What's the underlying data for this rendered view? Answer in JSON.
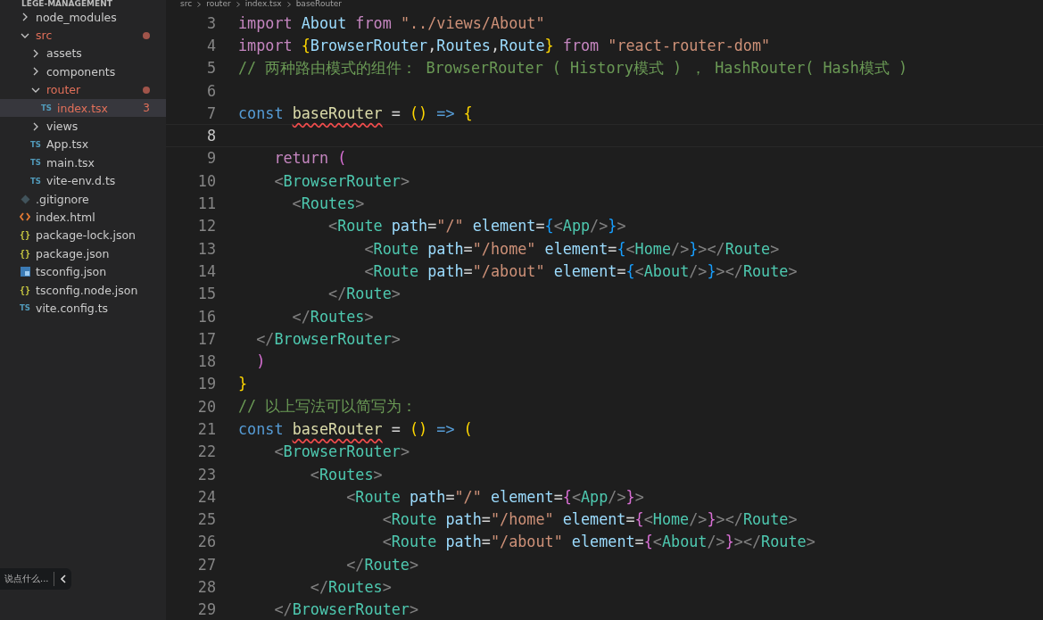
{
  "sidebar": {
    "title": "LEGE-MANAGEMENT",
    "tree": [
      {
        "name": "node_modules",
        "kind": "folder",
        "expanded": false,
        "modified": false,
        "selected": false
      },
      {
        "name": "src",
        "kind": "folder",
        "expanded": true,
        "modified": true,
        "selected": false,
        "children": [
          {
            "name": "assets",
            "kind": "folder",
            "expanded": false,
            "modified": false,
            "selected": false
          },
          {
            "name": "components",
            "kind": "folder",
            "expanded": false,
            "modified": false,
            "selected": false
          },
          {
            "name": "router",
            "kind": "folder",
            "expanded": true,
            "modified": true,
            "selected": false,
            "children": [
              {
                "name": "index.tsx",
                "kind": "ts",
                "modified": true,
                "selected": true,
                "badge": "3",
                "icon_text": "TS"
              }
            ]
          },
          {
            "name": "views",
            "kind": "folder",
            "expanded": false,
            "modified": false,
            "selected": false
          },
          {
            "name": "App.tsx",
            "kind": "ts",
            "modified": false,
            "selected": false,
            "icon_text": "TS"
          },
          {
            "name": "main.tsx",
            "kind": "ts",
            "modified": false,
            "selected": false,
            "icon_text": "TS"
          },
          {
            "name": "vite-env.d.ts",
            "kind": "ts",
            "modified": false,
            "selected": false,
            "icon_text": "TS"
          }
        ]
      },
      {
        "name": ".gitignore",
        "kind": "git",
        "modified": false,
        "selected": false
      },
      {
        "name": "index.html",
        "kind": "html",
        "modified": false,
        "selected": false
      },
      {
        "name": "package-lock.json",
        "kind": "json",
        "modified": false,
        "selected": false,
        "icon_text": "{}"
      },
      {
        "name": "package.json",
        "kind": "json",
        "modified": false,
        "selected": false,
        "icon_text": "{}"
      },
      {
        "name": "tsconfig.json",
        "kind": "tsconfig",
        "modified": false,
        "selected": false
      },
      {
        "name": "tsconfig.node.json",
        "kind": "json",
        "modified": false,
        "selected": false,
        "icon_text": "{}"
      },
      {
        "name": "vite.config.ts",
        "kind": "ts",
        "modified": false,
        "selected": false,
        "icon_text": "TS"
      }
    ]
  },
  "breadcrumb": [
    "src",
    "router",
    "index.tsx",
    "baseRouter"
  ],
  "editor": {
    "lines": [
      {
        "number": "3",
        "current": false,
        "tokens": [
          {
            "kind": "keyword",
            "text": "import "
          },
          {
            "kind": "variable",
            "text": "About "
          },
          {
            "kind": "keyword",
            "text": "from "
          },
          {
            "kind": "string",
            "text": "\"../views/About\""
          }
        ]
      },
      {
        "number": "4",
        "current": false,
        "tokens": [
          {
            "kind": "keyword",
            "text": "import "
          },
          {
            "kind": "bracket1",
            "text": "{"
          },
          {
            "kind": "variable",
            "text": "BrowserRouter"
          },
          {
            "kind": "plain",
            "text": ","
          },
          {
            "kind": "variable",
            "text": "Routes"
          },
          {
            "kind": "plain",
            "text": ","
          },
          {
            "kind": "variable",
            "text": "Route"
          },
          {
            "kind": "bracket1",
            "text": "} "
          },
          {
            "kind": "keyword",
            "text": "from "
          },
          {
            "kind": "string",
            "text": "\"react-router-dom\""
          }
        ]
      },
      {
        "number": "5",
        "current": false,
        "tokens": [
          {
            "kind": "comment",
            "text": "// 两种路由模式的组件： BrowserRouter ( History模式 ) ， HashRouter( Hash模式 )"
          }
        ]
      },
      {
        "number": "6",
        "current": false
      },
      {
        "number": "7",
        "current": false,
        "tokens": [
          {
            "kind": "storage",
            "text": "const "
          },
          {
            "kind": "function",
            "text": "baseRouter",
            "error": true
          },
          {
            "kind": "plain",
            "text": " = "
          },
          {
            "kind": "bracket1",
            "text": "() "
          },
          {
            "kind": "storage",
            "text": "=> "
          },
          {
            "kind": "bracket1",
            "text": "{"
          }
        ]
      },
      {
        "number": "8",
        "current": true
      },
      {
        "number": "9",
        "current": false,
        "tokens": [
          {
            "kind": "keyword",
            "text": "    return "
          },
          {
            "kind": "bracket2",
            "text": "("
          }
        ]
      },
      {
        "number": "10",
        "current": false,
        "tokens": [
          {
            "kind": "punct",
            "text": "    <"
          },
          {
            "kind": "tag",
            "text": "BrowserRouter"
          },
          {
            "kind": "punct",
            "text": ">"
          }
        ]
      },
      {
        "number": "11",
        "current": false,
        "tokens": [
          {
            "kind": "punct",
            "text": "      <"
          },
          {
            "kind": "tag",
            "text": "Routes"
          },
          {
            "kind": "punct",
            "text": ">"
          }
        ]
      },
      {
        "number": "12",
        "current": false,
        "tokens": [
          {
            "kind": "punct",
            "text": "          <"
          },
          {
            "kind": "tag",
            "text": "Route "
          },
          {
            "kind": "attr",
            "text": "path"
          },
          {
            "kind": "plain",
            "text": "="
          },
          {
            "kind": "string",
            "text": "\"/\" "
          },
          {
            "kind": "attr",
            "text": "element"
          },
          {
            "kind": "plain",
            "text": "="
          },
          {
            "kind": "bracket3",
            "text": "{"
          },
          {
            "kind": "punct",
            "text": "<"
          },
          {
            "kind": "tag",
            "text": "App"
          },
          {
            "kind": "punct",
            "text": "/>"
          },
          {
            "kind": "bracket3",
            "text": "}"
          },
          {
            "kind": "punct",
            "text": ">"
          }
        ]
      },
      {
        "number": "13",
        "current": false,
        "tokens": [
          {
            "kind": "punct",
            "text": "              <"
          },
          {
            "kind": "tag",
            "text": "Route "
          },
          {
            "kind": "attr",
            "text": "path"
          },
          {
            "kind": "plain",
            "text": "="
          },
          {
            "kind": "string",
            "text": "\"/home\" "
          },
          {
            "kind": "attr",
            "text": "element"
          },
          {
            "kind": "plain",
            "text": "="
          },
          {
            "kind": "bracket3",
            "text": "{"
          },
          {
            "kind": "punct",
            "text": "<"
          },
          {
            "kind": "tag",
            "text": "Home"
          },
          {
            "kind": "punct",
            "text": "/>"
          },
          {
            "kind": "bracket3",
            "text": "}"
          },
          {
            "kind": "punct",
            "text": "></"
          },
          {
            "kind": "tag",
            "text": "Route"
          },
          {
            "kind": "punct",
            "text": ">"
          }
        ]
      },
      {
        "number": "14",
        "current": false,
        "tokens": [
          {
            "kind": "punct",
            "text": "              <"
          },
          {
            "kind": "tag",
            "text": "Route "
          },
          {
            "kind": "attr",
            "text": "path"
          },
          {
            "kind": "plain",
            "text": "="
          },
          {
            "kind": "string",
            "text": "\"/about\" "
          },
          {
            "kind": "attr",
            "text": "element"
          },
          {
            "kind": "plain",
            "text": "="
          },
          {
            "kind": "bracket3",
            "text": "{"
          },
          {
            "kind": "punct",
            "text": "<"
          },
          {
            "kind": "tag",
            "text": "About"
          },
          {
            "kind": "punct",
            "text": "/>"
          },
          {
            "kind": "bracket3",
            "text": "}"
          },
          {
            "kind": "punct",
            "text": "></"
          },
          {
            "kind": "tag",
            "text": "Route"
          },
          {
            "kind": "punct",
            "text": ">"
          }
        ]
      },
      {
        "number": "15",
        "current": false,
        "tokens": [
          {
            "kind": "punct",
            "text": "          </"
          },
          {
            "kind": "tag",
            "text": "Route"
          },
          {
            "kind": "punct",
            "text": ">"
          }
        ]
      },
      {
        "number": "16",
        "current": false,
        "tokens": [
          {
            "kind": "punct",
            "text": "      </"
          },
          {
            "kind": "tag",
            "text": "Routes"
          },
          {
            "kind": "punct",
            "text": ">"
          }
        ]
      },
      {
        "number": "17",
        "current": false,
        "tokens": [
          {
            "kind": "punct",
            "text": "  </"
          },
          {
            "kind": "tag",
            "text": "BrowserRouter"
          },
          {
            "kind": "punct",
            "text": ">"
          }
        ]
      },
      {
        "number": "18",
        "current": false,
        "tokens": [
          {
            "kind": "bracket2",
            "text": "  )"
          }
        ]
      },
      {
        "number": "19",
        "current": false,
        "tokens": [
          {
            "kind": "bracket1",
            "text": "}"
          }
        ]
      },
      {
        "number": "20",
        "current": false,
        "tokens": [
          {
            "kind": "comment",
            "text": "// 以上写法可以简写为："
          }
        ]
      },
      {
        "number": "21",
        "current": false,
        "tokens": [
          {
            "kind": "storage",
            "text": "const "
          },
          {
            "kind": "function",
            "text": "baseRouter",
            "error": true
          },
          {
            "kind": "plain",
            "text": " = "
          },
          {
            "kind": "bracket1",
            "text": "() "
          },
          {
            "kind": "storage",
            "text": "=> "
          },
          {
            "kind": "bracket1",
            "text": "("
          }
        ]
      },
      {
        "number": "22",
        "current": false,
        "tokens": [
          {
            "kind": "punct",
            "text": "    <"
          },
          {
            "kind": "tag",
            "text": "BrowserRouter"
          },
          {
            "kind": "punct",
            "text": ">"
          }
        ]
      },
      {
        "number": "23",
        "current": false,
        "tokens": [
          {
            "kind": "punct",
            "text": "        <"
          },
          {
            "kind": "tag",
            "text": "Routes"
          },
          {
            "kind": "punct",
            "text": ">"
          }
        ]
      },
      {
        "number": "24",
        "current": false,
        "tokens": [
          {
            "kind": "punct",
            "text": "            <"
          },
          {
            "kind": "tag",
            "text": "Route "
          },
          {
            "kind": "attr",
            "text": "path"
          },
          {
            "kind": "plain",
            "text": "="
          },
          {
            "kind": "string",
            "text": "\"/\" "
          },
          {
            "kind": "attr",
            "text": "element"
          },
          {
            "kind": "plain",
            "text": "="
          },
          {
            "kind": "bracket2",
            "text": "{"
          },
          {
            "kind": "punct",
            "text": "<"
          },
          {
            "kind": "tag",
            "text": "App"
          },
          {
            "kind": "punct",
            "text": "/>"
          },
          {
            "kind": "bracket2",
            "text": "}"
          },
          {
            "kind": "punct",
            "text": ">"
          }
        ]
      },
      {
        "number": "25",
        "current": false,
        "tokens": [
          {
            "kind": "punct",
            "text": "                <"
          },
          {
            "kind": "tag",
            "text": "Route "
          },
          {
            "kind": "attr",
            "text": "path"
          },
          {
            "kind": "plain",
            "text": "="
          },
          {
            "kind": "string",
            "text": "\"/home\" "
          },
          {
            "kind": "attr",
            "text": "element"
          },
          {
            "kind": "plain",
            "text": "="
          },
          {
            "kind": "bracket2",
            "text": "{"
          },
          {
            "kind": "punct",
            "text": "<"
          },
          {
            "kind": "tag",
            "text": "Home"
          },
          {
            "kind": "punct",
            "text": "/>"
          },
          {
            "kind": "bracket2",
            "text": "}"
          },
          {
            "kind": "punct",
            "text": "></"
          },
          {
            "kind": "tag",
            "text": "Route"
          },
          {
            "kind": "punct",
            "text": ">"
          }
        ]
      },
      {
        "number": "26",
        "current": false,
        "tokens": [
          {
            "kind": "punct",
            "text": "                <"
          },
          {
            "kind": "tag",
            "text": "Route "
          },
          {
            "kind": "attr",
            "text": "path"
          },
          {
            "kind": "plain",
            "text": "="
          },
          {
            "kind": "string",
            "text": "\"/about\" "
          },
          {
            "kind": "attr",
            "text": "element"
          },
          {
            "kind": "plain",
            "text": "="
          },
          {
            "kind": "bracket2",
            "text": "{"
          },
          {
            "kind": "punct",
            "text": "<"
          },
          {
            "kind": "tag",
            "text": "About"
          },
          {
            "kind": "punct",
            "text": "/>"
          },
          {
            "kind": "bracket2",
            "text": "}"
          },
          {
            "kind": "punct",
            "text": "></"
          },
          {
            "kind": "tag",
            "text": "Route"
          },
          {
            "kind": "punct",
            "text": ">"
          }
        ]
      },
      {
        "number": "27",
        "current": false,
        "tokens": [
          {
            "kind": "punct",
            "text": "            </"
          },
          {
            "kind": "tag",
            "text": "Route"
          },
          {
            "kind": "punct",
            "text": ">"
          }
        ]
      },
      {
        "number": "28",
        "current": false,
        "tokens": [
          {
            "kind": "punct",
            "text": "        </"
          },
          {
            "kind": "tag",
            "text": "Routes"
          },
          {
            "kind": "punct",
            "text": ">"
          }
        ]
      },
      {
        "number": "29",
        "current": false,
        "tokens": [
          {
            "kind": "punct",
            "text": "    </"
          },
          {
            "kind": "tag",
            "text": "BrowserRouter"
          },
          {
            "kind": "punct",
            "text": ">"
          }
        ]
      }
    ]
  },
  "comment_widget": {
    "placeholder": "说点什么..."
  }
}
